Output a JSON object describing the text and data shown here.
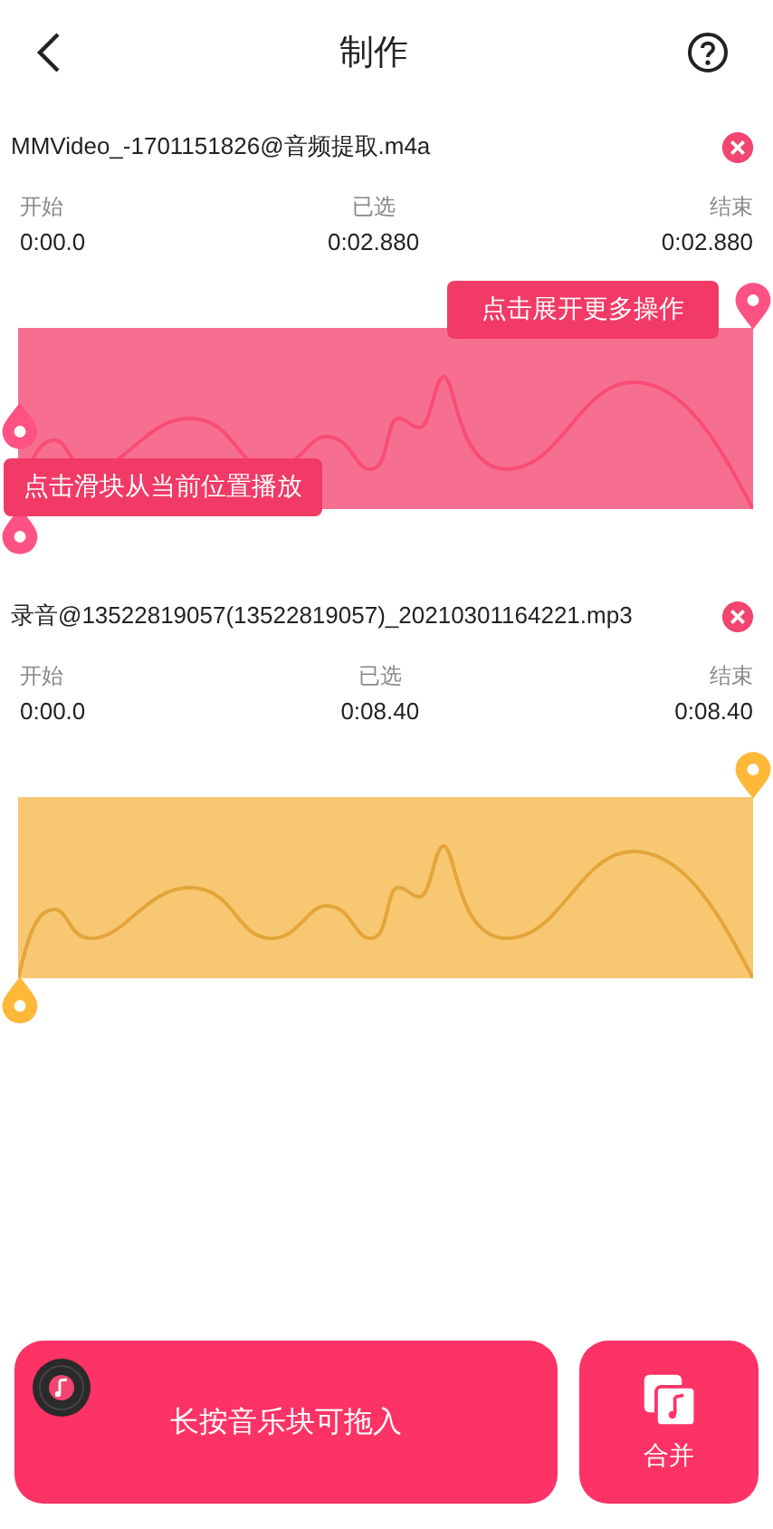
{
  "header": {
    "title": "制作"
  },
  "tracks": [
    {
      "file": "MMVideo_-1701151826@音频提取.m4a",
      "start_label": "开始",
      "start": "0:00.0",
      "selected_label": "已选",
      "selected_time": "0:02.880",
      "end_label": "结束",
      "end": "0:02.880",
      "color": "#f7678a",
      "playhead": true,
      "tips": [
        {
          "kind": "top",
          "text": "点击展开更多操作"
        },
        {
          "kind": "bottom",
          "text": "点击滑块从当前位置播放"
        }
      ]
    },
    {
      "file": "录音@13522819057(13522819057)_20210301164221.mp3",
      "start_label": "开始",
      "start": "0:00.0",
      "selected_label": "已选",
      "selected_time": "0:08.40",
      "end_label": "结束",
      "end": "0:08.40",
      "color": "#f8c46a",
      "playhead": false
    }
  ],
  "bottom": {
    "drag_hint": "长按音乐块可拖入",
    "merge_label": "合并"
  }
}
